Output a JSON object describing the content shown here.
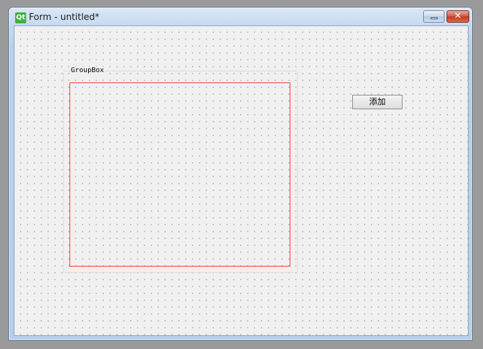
{
  "window": {
    "title": "Form - untitled*",
    "app_icon": "qt-logo-icon",
    "app_icon_text": "Qt",
    "close_glyph": "✕"
  },
  "form": {
    "groupbox": {
      "title": "GroupBox"
    },
    "add_button": {
      "label": "添加"
    }
  },
  "colors": {
    "layout_outline": "#ff3333",
    "qt_green": "#41b040",
    "close_red": "#c23a1f"
  }
}
